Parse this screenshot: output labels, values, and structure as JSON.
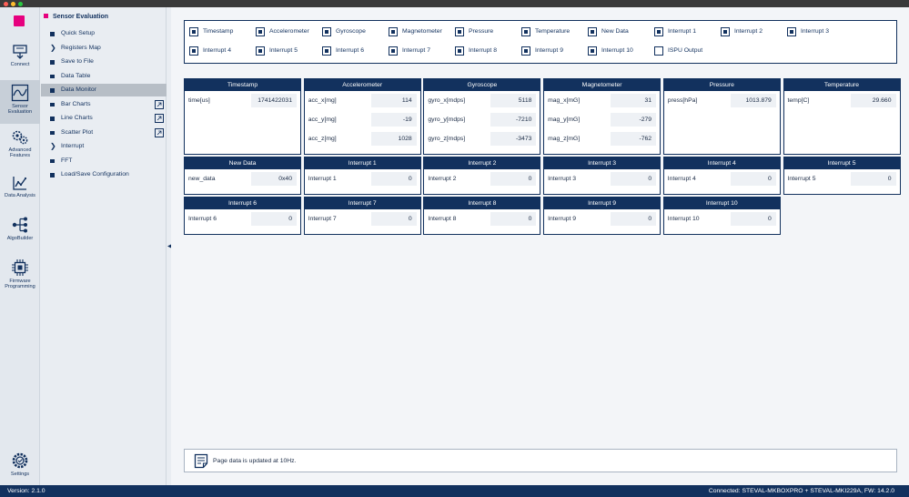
{
  "rail": [
    {
      "id": "connect",
      "label": "Connect",
      "icon": "connect-icon"
    },
    {
      "id": "sensor-evaluation",
      "label": "Sensor Evaluation",
      "icon": "sensor-evaluation-icon",
      "active": true
    },
    {
      "id": "advanced-features",
      "label": "Advanced Features",
      "icon": "gears-icon"
    },
    {
      "id": "data-analysis",
      "label": "Data Analysis",
      "icon": "data-analysis-icon"
    },
    {
      "id": "algobuilder",
      "label": "AlgoBuilder",
      "icon": "algobuilder-icon"
    },
    {
      "id": "firmware-programming",
      "label": "Firmware Programming",
      "icon": "chip-icon"
    },
    {
      "id": "settings",
      "label": "Settings",
      "icon": "settings-icon"
    }
  ],
  "menu": {
    "title": "Sensor Evaluation",
    "items": [
      {
        "label": "Quick Setup",
        "marker": "bullet"
      },
      {
        "label": "Registers Map",
        "marker": "chevron"
      },
      {
        "label": "Save to File",
        "marker": "bullet"
      },
      {
        "label": "Data Table",
        "marker": "bullet"
      },
      {
        "label": "Data Monitor",
        "marker": "bullet",
        "active": true
      },
      {
        "label": "Bar Charts",
        "marker": "bullet",
        "external": true
      },
      {
        "label": "Line Charts",
        "marker": "bullet",
        "external": true
      },
      {
        "label": "Scatter Plot",
        "marker": "bullet",
        "external": true
      },
      {
        "label": "Interrupt",
        "marker": "chevron"
      },
      {
        "label": "FFT",
        "marker": "bullet"
      },
      {
        "label": "Load/Save Configuration",
        "marker": "bullet"
      }
    ]
  },
  "checkboxes": [
    {
      "label": "Timestamp",
      "checked": true
    },
    {
      "label": "Accelerometer",
      "checked": true
    },
    {
      "label": "Gyroscope",
      "checked": true
    },
    {
      "label": "Magnetometer",
      "checked": true
    },
    {
      "label": "Pressure",
      "checked": true
    },
    {
      "label": "Temperature",
      "checked": true
    },
    {
      "label": "New Data",
      "checked": true
    },
    {
      "label": "Interrupt 1",
      "checked": true
    },
    {
      "label": "Interrupt 2",
      "checked": true
    },
    {
      "label": "Interrupt 3",
      "checked": true
    },
    {
      "label": "Interrupt 4",
      "checked": true
    },
    {
      "label": "Interrupt 5",
      "checked": true
    },
    {
      "label": "Interrupt 6",
      "checked": true
    },
    {
      "label": "Interrupt 7",
      "checked": true
    },
    {
      "label": "Interrupt 8",
      "checked": true
    },
    {
      "label": "Interrupt 9",
      "checked": true
    },
    {
      "label": "Interrupt 10",
      "checked": true
    },
    {
      "label": "ISPU Output",
      "checked": false
    }
  ],
  "cards": [
    {
      "title": "Timestamp",
      "rows": [
        {
          "label": "time[us]",
          "value": "1741422031"
        }
      ]
    },
    {
      "title": "Accelerometer",
      "rows": [
        {
          "label": "acc_x[mg]",
          "value": "114"
        },
        {
          "label": "acc_y[mg]",
          "value": "-19"
        },
        {
          "label": "acc_z[mg]",
          "value": "1028"
        }
      ]
    },
    {
      "title": "Gyroscope",
      "rows": [
        {
          "label": "gyro_x[mdps]",
          "value": "5118"
        },
        {
          "label": "gyro_y[mdps]",
          "value": "-7210"
        },
        {
          "label": "gyro_z[mdps]",
          "value": "-3473"
        }
      ]
    },
    {
      "title": "Magnetometer",
      "rows": [
        {
          "label": "mag_x[mG]",
          "value": "31"
        },
        {
          "label": "mag_y[mG]",
          "value": "-279"
        },
        {
          "label": "mag_z[mG]",
          "value": "-762"
        }
      ]
    },
    {
      "title": "Pressure",
      "rows": [
        {
          "label": "press[hPa]",
          "value": "1013.879"
        }
      ]
    },
    {
      "title": "Temperature",
      "rows": [
        {
          "label": "temp[C]",
          "value": "29.660"
        }
      ]
    },
    {
      "title": "New Data",
      "rows": [
        {
          "label": "new_data",
          "value": "0x40"
        }
      ]
    },
    {
      "title": "Interrupt 1",
      "rows": [
        {
          "label": "Interrupt 1",
          "value": "0"
        }
      ]
    },
    {
      "title": "Interrupt 2",
      "rows": [
        {
          "label": "Interrupt 2",
          "value": "0"
        }
      ]
    },
    {
      "title": "Interrupt 3",
      "rows": [
        {
          "label": "Interrupt 3",
          "value": "0"
        }
      ]
    },
    {
      "title": "Interrupt 4",
      "rows": [
        {
          "label": "Interrupt 4",
          "value": "0"
        }
      ]
    },
    {
      "title": "Interrupt 5",
      "rows": [
        {
          "label": "Interrupt 5",
          "value": "0"
        }
      ]
    },
    {
      "title": "Interrupt 6",
      "rows": [
        {
          "label": "Interrupt 6",
          "value": "0"
        }
      ]
    },
    {
      "title": "Interrupt 7",
      "rows": [
        {
          "label": "Interrupt 7",
          "value": "0"
        }
      ]
    },
    {
      "title": "Interrupt 8",
      "rows": [
        {
          "label": "Interrupt 8",
          "value": "0"
        }
      ]
    },
    {
      "title": "Interrupt 9",
      "rows": [
        {
          "label": "Interrupt 9",
          "value": "0"
        }
      ]
    },
    {
      "title": "Interrupt 10",
      "rows": [
        {
          "label": "Interrupt 10",
          "value": "0"
        }
      ]
    }
  ],
  "footnote": "Page data is updated at 10Hz.",
  "status": {
    "version": "Version: 2.1.0",
    "connection": "Connected:  STEVAL-MKBOXPRO + STEVAL-MKI229A, FW: 14.2.0"
  },
  "colors": {
    "accent": "#e6007e",
    "navy": "#12315e"
  }
}
